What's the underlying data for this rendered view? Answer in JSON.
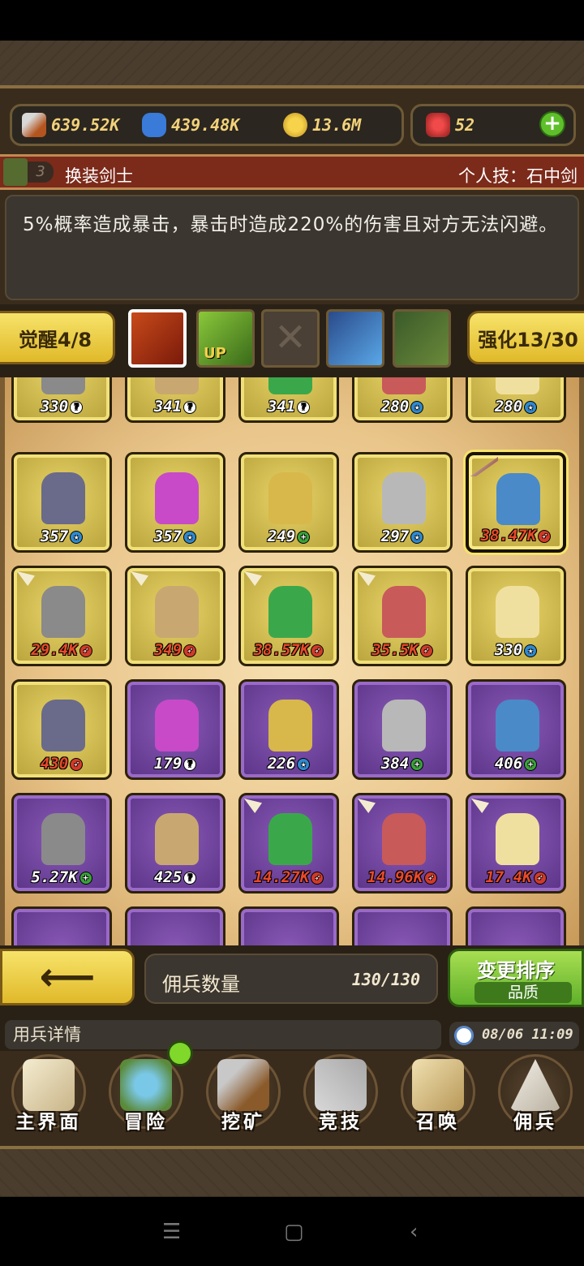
{
  "resources": {
    "attack": "639.52K",
    "exp": "439.48K",
    "gold": "13.6M",
    "gems": "52"
  },
  "skill": {
    "level": "3",
    "name": "换装剑士",
    "personal": "个人技：石中剑",
    "description": "5%概率造成暴击，暴击时造成220%的伤害且对方无法闪避。"
  },
  "tabs": {
    "awaken": "觉醒4/8",
    "enhance": "强化13/30",
    "up_label": "UP"
  },
  "grid_rows": [
    [
      {
        "value": "330",
        "badge": "?",
        "tier": "gold"
      },
      {
        "value": "341",
        "badge": "?",
        "tier": "gold"
      },
      {
        "value": "341",
        "badge": "?",
        "tier": "gold"
      },
      {
        "value": "280",
        "badge": "★",
        "tier": "gold"
      },
      {
        "value": "280",
        "badge": "★",
        "tier": "gold"
      }
    ],
    [
      {
        "value": "357",
        "badge": "★",
        "tier": "gold"
      },
      {
        "value": "357",
        "badge": "★",
        "tier": "gold"
      },
      {
        "value": "249",
        "badge": "+",
        "tier": "gold"
      },
      {
        "value": "297",
        "badge": "★",
        "tier": "gold"
      },
      {
        "value": "38.47K",
        "badge": "➶",
        "tier": "gold",
        "selected": true
      }
    ],
    [
      {
        "value": "29.4K",
        "badge": "➶",
        "tier": "gold"
      },
      {
        "value": "349",
        "badge": "➶",
        "tier": "gold"
      },
      {
        "value": "38.57K",
        "badge": "➶",
        "tier": "gold"
      },
      {
        "value": "35.5K",
        "badge": "➶",
        "tier": "gold"
      },
      {
        "value": "330",
        "badge": "★",
        "tier": "gold"
      }
    ],
    [
      {
        "value": "430",
        "badge": "➶",
        "tier": "gold"
      },
      {
        "value": "179",
        "badge": "?",
        "tier": "purple"
      },
      {
        "value": "226",
        "badge": "★",
        "tier": "purple"
      },
      {
        "value": "384",
        "badge": "+",
        "tier": "purple"
      },
      {
        "value": "406",
        "badge": "+",
        "tier": "purple"
      }
    ],
    [
      {
        "value": "5.27K",
        "badge": "+",
        "tier": "purple"
      },
      {
        "value": "425",
        "badge": "?",
        "tier": "purple"
      },
      {
        "value": "14.27K",
        "badge": "➶",
        "tier": "purple"
      },
      {
        "value": "14.96K",
        "badge": "➶",
        "tier": "purple"
      },
      {
        "value": "17.4K",
        "badge": "➶",
        "tier": "purple"
      }
    ]
  ],
  "count": {
    "label": "佣兵数量",
    "value": "130/130"
  },
  "sort": {
    "label": "变更排序",
    "mode": "品质"
  },
  "ticker": {
    "text": "用兵详情",
    "time": "08/06 11:09"
  },
  "nav": [
    {
      "label": "主界面",
      "icon": "map-scroll-icon"
    },
    {
      "label": "冒险",
      "icon": "island-icon"
    },
    {
      "label": "挖矿",
      "icon": "pickaxe-icon"
    },
    {
      "label": "竞技",
      "icon": "crossed-swords-icon"
    },
    {
      "label": "召唤",
      "icon": "summon-scroll-icon"
    },
    {
      "label": "佣兵",
      "icon": "tent-icon"
    }
  ],
  "colors": {
    "gold_card": "#e9d66a",
    "purple_card": "#8a5ab8",
    "accent_green": "#5fb02a",
    "value_red": "#e84a2a"
  }
}
